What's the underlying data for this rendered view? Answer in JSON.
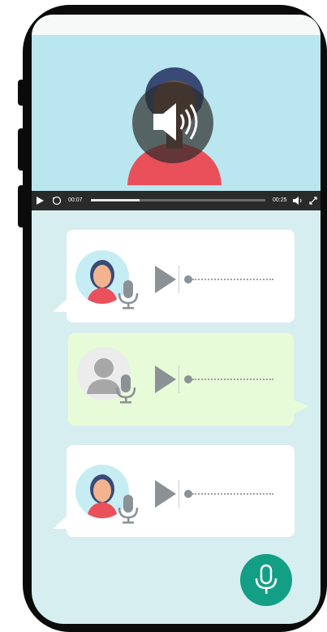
{
  "player": {
    "current_time": "00:07",
    "duration": "00:25",
    "progress_fraction": 0.28
  },
  "messages": [
    {
      "type": "received",
      "avatar": "woman-avatar",
      "state": "paused"
    },
    {
      "type": "sent",
      "avatar": "generic-user-avatar",
      "state": "paused"
    },
    {
      "type": "received",
      "avatar": "woman-avatar",
      "state": "paused"
    }
  ],
  "colors": {
    "screen_bg": "#d7eef0",
    "video_bg": "#b9e6ef",
    "sent_bubble": "#e8fbd8",
    "received_bubble": "#ffffff",
    "fab": "#129f86"
  },
  "icons": [
    "play-icon",
    "replay-10-icon",
    "speaker-icon",
    "fullscreen-icon",
    "microphone-icon"
  ]
}
